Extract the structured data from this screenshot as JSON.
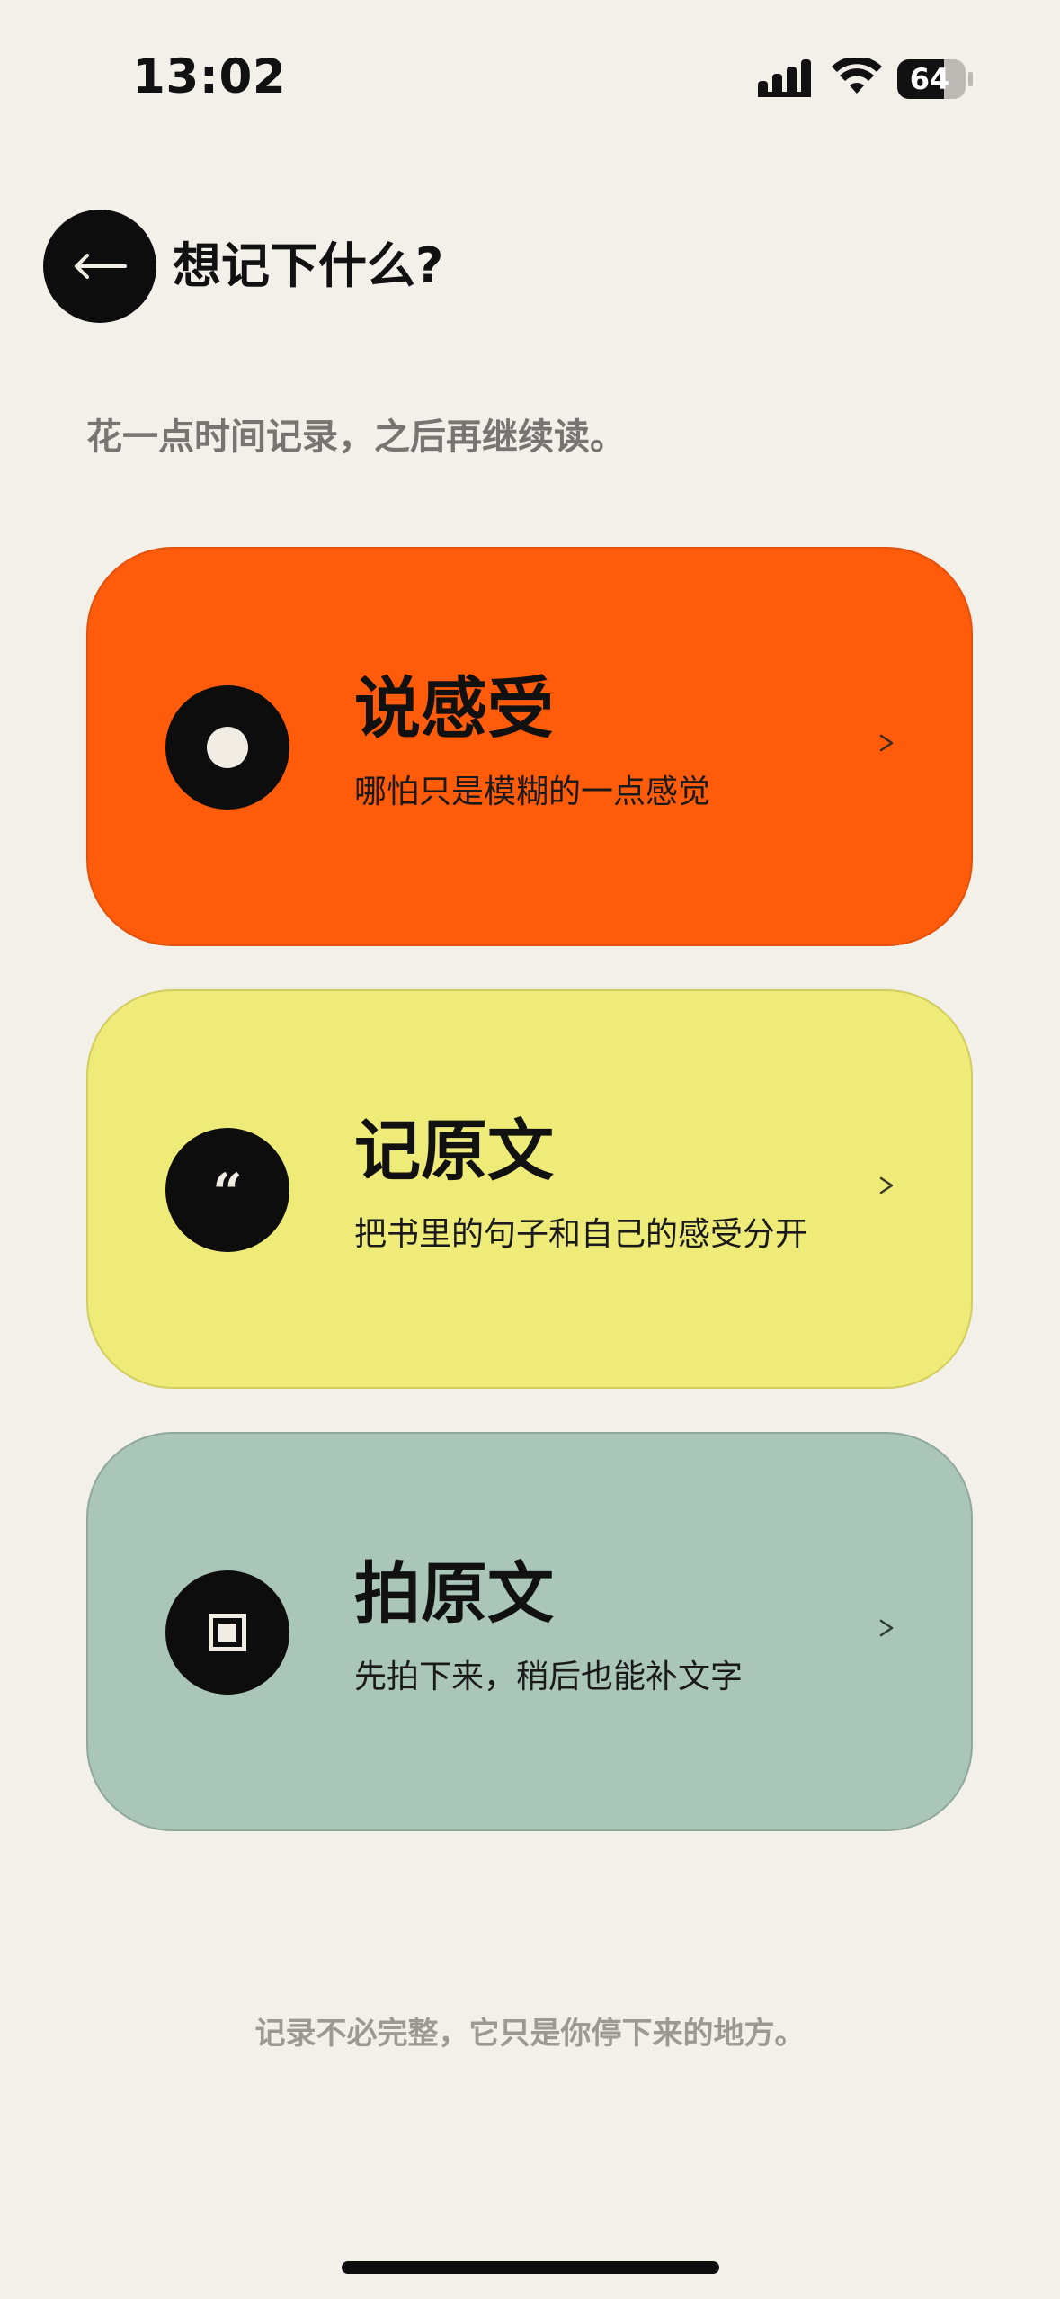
{
  "status_bar": {
    "time": "13:02",
    "battery_level": "64"
  },
  "header": {
    "title": "想记下什么?",
    "back_icon": "arrow-left-icon"
  },
  "subtitle": "花一点时间记录，之后再继续读。",
  "cards": [
    {
      "title": "说感受",
      "description": "哪怕只是模糊的一点感觉",
      "icon": "dot-icon",
      "color": "#fe5b0b"
    },
    {
      "title": "记原文",
      "description": "把书里的句子和自己的感受分开",
      "icon": "quote-icon",
      "icon_glyph": "“",
      "color": "#efeb78"
    },
    {
      "title": "拍原文",
      "description": "先拍下来，稍后也能补文字",
      "icon": "camera-frame-icon",
      "color": "#a9c6b8"
    }
  ],
  "footer_note": "记录不必完整，它只是你停下来的地方。",
  "colors": {
    "background": "#f3f0ea",
    "dark": "#0d0d0d"
  }
}
